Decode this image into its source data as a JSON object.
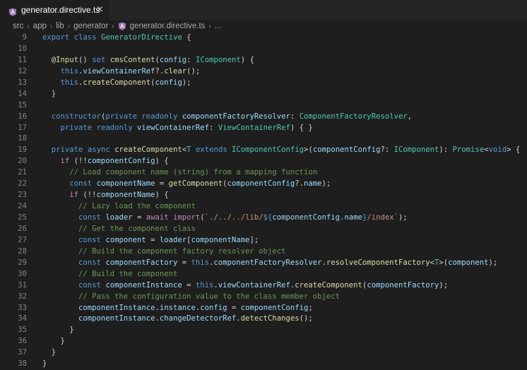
{
  "tab": {
    "title": "generator.directive.ts",
    "close_glyph": "×",
    "icon": "angular-icon"
  },
  "breadcrumb": [
    "src",
    "app",
    "lib",
    "generator",
    "generator.directive.ts",
    "..."
  ],
  "breadcrumb_separator": "›",
  "line_numbers": [
    "9",
    "10",
    "11",
    "12",
    "13",
    "14",
    "15",
    "16",
    "17",
    "18",
    "19",
    "20",
    "21",
    "22",
    "23",
    "24",
    "25",
    "26",
    "27",
    "28",
    "29",
    "30",
    "31",
    "32",
    "33",
    "34",
    "35",
    "36",
    "37",
    "38"
  ],
  "code_lines": [
    [
      [
        "k",
        "export"
      ],
      [
        "p",
        " "
      ],
      [
        "k",
        "class"
      ],
      [
        "p",
        " "
      ],
      [
        "t",
        "GeneratorDirective"
      ],
      [
        "p",
        " {"
      ]
    ],
    [],
    [
      [
        "p",
        "  "
      ],
      [
        "f",
        "@Input"
      ],
      [
        "p",
        "() "
      ],
      [
        "k",
        "set"
      ],
      [
        "p",
        " "
      ],
      [
        "f",
        "cmsContent"
      ],
      [
        "p",
        "("
      ],
      [
        "v",
        "config"
      ],
      [
        "p",
        ": "
      ],
      [
        "t",
        "IComponent"
      ],
      [
        "p",
        ") {"
      ]
    ],
    [
      [
        "p",
        "    "
      ],
      [
        "k",
        "this"
      ],
      [
        "p",
        "."
      ],
      [
        "v",
        "viewContainerRef"
      ],
      [
        "p",
        "?."
      ],
      [
        "f",
        "clear"
      ],
      [
        "p",
        "();"
      ]
    ],
    [
      [
        "p",
        "    "
      ],
      [
        "k",
        "this"
      ],
      [
        "p",
        "."
      ],
      [
        "f",
        "createComponent"
      ],
      [
        "p",
        "("
      ],
      [
        "v",
        "config"
      ],
      [
        "p",
        ");"
      ]
    ],
    [
      [
        "p",
        "  }"
      ]
    ],
    [],
    [
      [
        "p",
        "  "
      ],
      [
        "k",
        "constructor"
      ],
      [
        "p",
        "("
      ],
      [
        "k",
        "private"
      ],
      [
        "p",
        " "
      ],
      [
        "k",
        "readonly"
      ],
      [
        "p",
        " "
      ],
      [
        "v",
        "componentFactoryResolver"
      ],
      [
        "p",
        ": "
      ],
      [
        "t",
        "ComponentFactoryResolver"
      ],
      [
        "p",
        ","
      ]
    ],
    [
      [
        "p",
        "    "
      ],
      [
        "k",
        "private"
      ],
      [
        "p",
        " "
      ],
      [
        "k",
        "readonly"
      ],
      [
        "p",
        " "
      ],
      [
        "v",
        "viewContainerRef"
      ],
      [
        "p",
        ": "
      ],
      [
        "t",
        "ViewContainerRef"
      ],
      [
        "p",
        ") { }"
      ]
    ],
    [],
    [
      [
        "p",
        "  "
      ],
      [
        "k",
        "private"
      ],
      [
        "p",
        " "
      ],
      [
        "k",
        "async"
      ],
      [
        "p",
        " "
      ],
      [
        "f",
        "createComponent"
      ],
      [
        "p",
        "<"
      ],
      [
        "t",
        "T"
      ],
      [
        "p",
        " "
      ],
      [
        "k",
        "extends"
      ],
      [
        "p",
        " "
      ],
      [
        "t",
        "IComponentConfig"
      ],
      [
        "p",
        ">("
      ],
      [
        "v",
        "componentConfig"
      ],
      [
        "p",
        "?: "
      ],
      [
        "t",
        "IComponent"
      ],
      [
        "p",
        "): "
      ],
      [
        "t",
        "Promise"
      ],
      [
        "p",
        "<"
      ],
      [
        "k",
        "void"
      ],
      [
        "p",
        "> {"
      ]
    ],
    [
      [
        "p",
        "    "
      ],
      [
        "c",
        "if"
      ],
      [
        "p",
        " (!!"
      ],
      [
        "v",
        "componentConfig"
      ],
      [
        "p",
        ") {"
      ]
    ],
    [
      [
        "p",
        "      "
      ],
      [
        "m",
        "// Load component name (string) from a mapping function"
      ]
    ],
    [
      [
        "p",
        "      "
      ],
      [
        "k",
        "const"
      ],
      [
        "p",
        " "
      ],
      [
        "v",
        "componentName"
      ],
      [
        "p",
        " = "
      ],
      [
        "f",
        "getComponent"
      ],
      [
        "p",
        "("
      ],
      [
        "v",
        "componentConfig"
      ],
      [
        "p",
        "?."
      ],
      [
        "v",
        "name"
      ],
      [
        "p",
        ");"
      ]
    ],
    [
      [
        "p",
        "      "
      ],
      [
        "c",
        "if"
      ],
      [
        "p",
        " (!!"
      ],
      [
        "v",
        "componentName"
      ],
      [
        "p",
        ") {"
      ]
    ],
    [
      [
        "p",
        "        "
      ],
      [
        "m",
        "// Lazy load the component"
      ]
    ],
    [
      [
        "p",
        "        "
      ],
      [
        "k",
        "const"
      ],
      [
        "p",
        " "
      ],
      [
        "v",
        "loader"
      ],
      [
        "p",
        " = "
      ],
      [
        "c",
        "await"
      ],
      [
        "p",
        " "
      ],
      [
        "c",
        "import"
      ],
      [
        "p",
        "("
      ],
      [
        "s",
        "`./../../lib/"
      ],
      [
        "k",
        "${"
      ],
      [
        "v",
        "componentConfig"
      ],
      [
        "p",
        "."
      ],
      [
        "v",
        "name"
      ],
      [
        "k",
        "}"
      ],
      [
        "s",
        "/index`"
      ],
      [
        "p",
        ");"
      ]
    ],
    [
      [
        "p",
        "        "
      ],
      [
        "m",
        "// Get the component class"
      ]
    ],
    [
      [
        "p",
        "        "
      ],
      [
        "k",
        "const"
      ],
      [
        "p",
        " "
      ],
      [
        "v",
        "component"
      ],
      [
        "p",
        " = "
      ],
      [
        "v",
        "loader"
      ],
      [
        "p",
        "["
      ],
      [
        "v",
        "componentName"
      ],
      [
        "p",
        "];"
      ]
    ],
    [
      [
        "p",
        "        "
      ],
      [
        "m",
        "// Build the component factory resolver object"
      ]
    ],
    [
      [
        "p",
        "        "
      ],
      [
        "k",
        "const"
      ],
      [
        "p",
        " "
      ],
      [
        "v",
        "componentFactory"
      ],
      [
        "p",
        " = "
      ],
      [
        "k",
        "this"
      ],
      [
        "p",
        "."
      ],
      [
        "v",
        "componentFactoryResolver"
      ],
      [
        "p",
        "."
      ],
      [
        "f",
        "resolveComponentFactory"
      ],
      [
        "p",
        "<"
      ],
      [
        "t",
        "T"
      ],
      [
        "p",
        ">("
      ],
      [
        "v",
        "component"
      ],
      [
        "p",
        ");"
      ]
    ],
    [
      [
        "p",
        "        "
      ],
      [
        "m",
        "// Build the component"
      ]
    ],
    [
      [
        "p",
        "        "
      ],
      [
        "k",
        "const"
      ],
      [
        "p",
        " "
      ],
      [
        "v",
        "componentInstance"
      ],
      [
        "p",
        " = "
      ],
      [
        "k",
        "this"
      ],
      [
        "p",
        "."
      ],
      [
        "v",
        "viewContainerRef"
      ],
      [
        "p",
        "."
      ],
      [
        "f",
        "createComponent"
      ],
      [
        "p",
        "("
      ],
      [
        "v",
        "componentFactory"
      ],
      [
        "p",
        ");"
      ]
    ],
    [
      [
        "p",
        "        "
      ],
      [
        "m",
        "// Pass the configuration value to the class member object"
      ]
    ],
    [
      [
        "p",
        "        "
      ],
      [
        "v",
        "componentInstance"
      ],
      [
        "p",
        "."
      ],
      [
        "v",
        "instance"
      ],
      [
        "p",
        "."
      ],
      [
        "v",
        "config"
      ],
      [
        "p",
        " = "
      ],
      [
        "v",
        "componentConfig"
      ],
      [
        "p",
        ";"
      ]
    ],
    [
      [
        "p",
        "        "
      ],
      [
        "v",
        "componentInstance"
      ],
      [
        "p",
        "."
      ],
      [
        "v",
        "changeDetectorRef"
      ],
      [
        "p",
        "."
      ],
      [
        "f",
        "detectChanges"
      ],
      [
        "p",
        "();"
      ]
    ],
    [
      [
        "p",
        "      }"
      ]
    ],
    [
      [
        "p",
        "    }"
      ]
    ],
    [
      [
        "p",
        "  }"
      ]
    ],
    [
      [
        "p",
        "}"
      ]
    ]
  ],
  "colors": {
    "editor_bg": "#1e1e1e",
    "keyword": "#569cd6",
    "control": "#c586c0",
    "type": "#4ec9b0",
    "function": "#dcdcaa",
    "variable": "#9cdcfe",
    "string": "#ce9178",
    "comment": "#6a9955",
    "angular_icon": "#c3002f"
  }
}
